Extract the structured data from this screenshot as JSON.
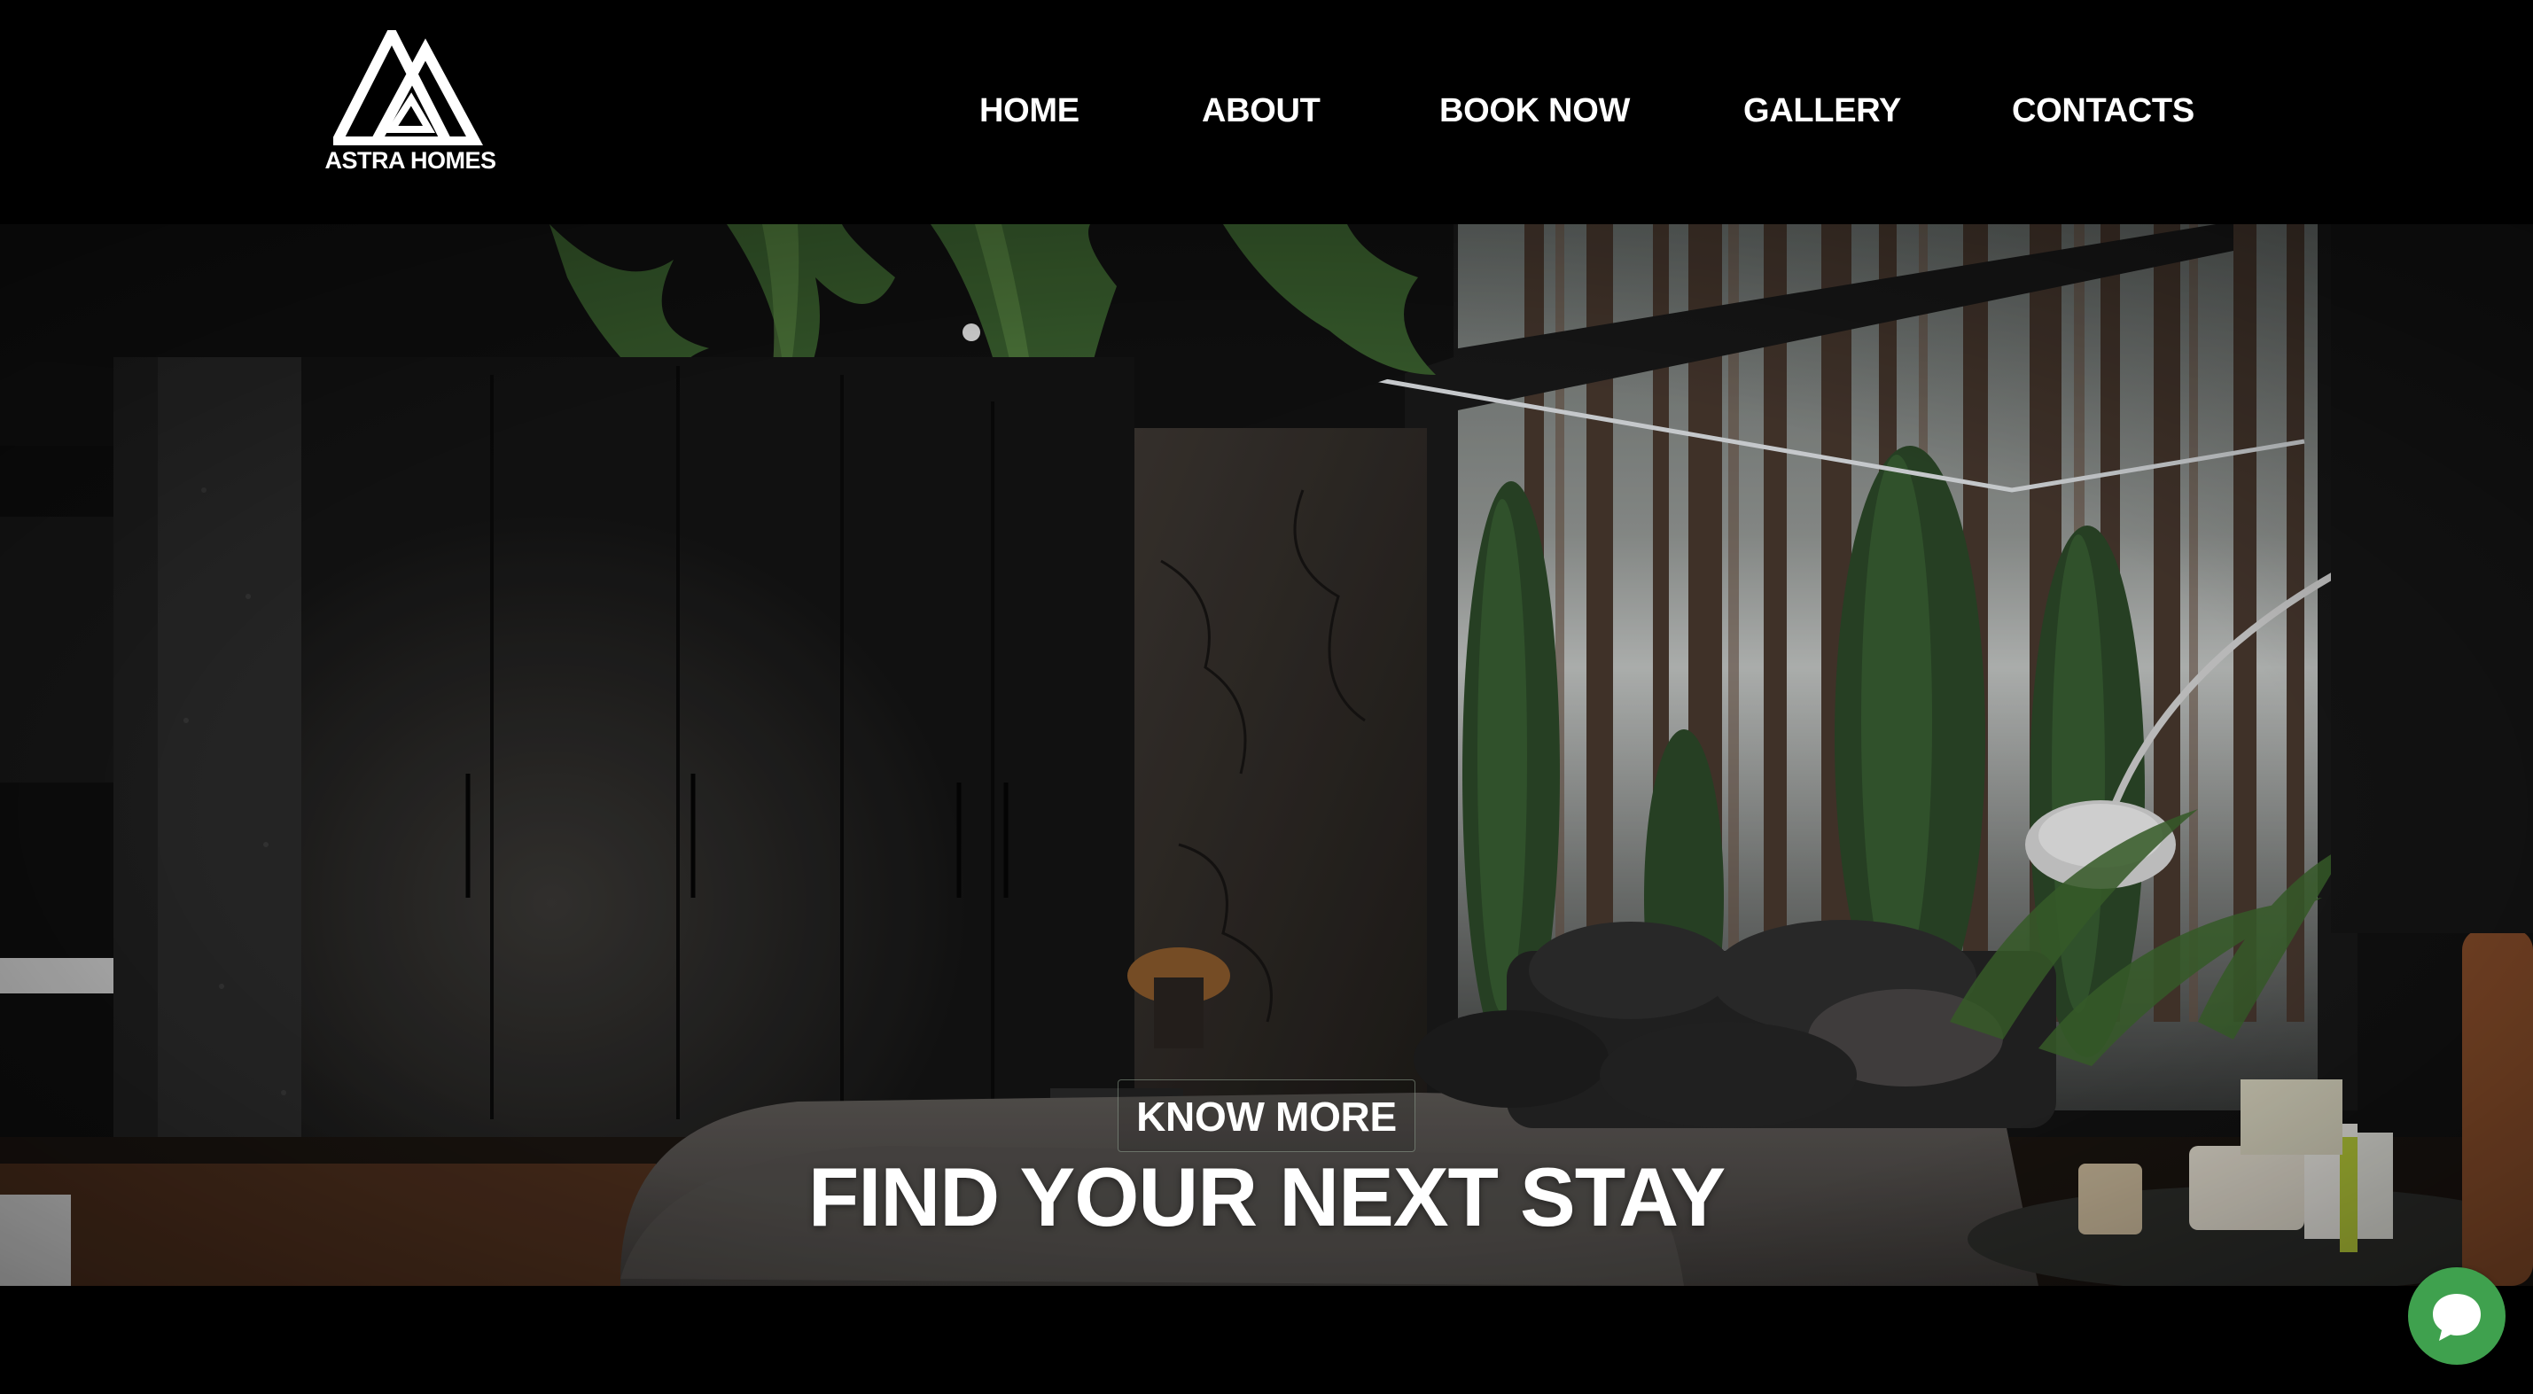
{
  "brand": {
    "name": "ASTRA HOMES",
    "logo_icon": "double-triangle-logo-icon"
  },
  "nav": {
    "items": [
      {
        "label": "HOME"
      },
      {
        "label": "ABOUT"
      },
      {
        "label": "BOOK NOW"
      },
      {
        "label": "GALLERY"
      },
      {
        "label": "CONTACTS"
      }
    ]
  },
  "hero": {
    "title": "FIND YOUR NEXT STAY",
    "button_label": "KNOW MORE",
    "background_description_icon": "bedroom-forest-photo"
  },
  "chat": {
    "icon": "chat-bubble-icon",
    "color": "#3fa14e"
  },
  "colors": {
    "header_bg": "#000000",
    "text": "#ffffff"
  }
}
